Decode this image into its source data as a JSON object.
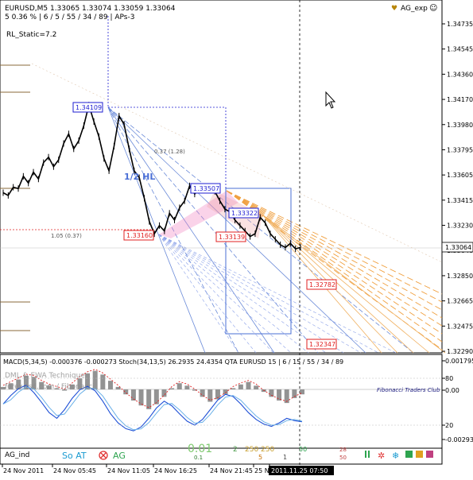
{
  "header": {
    "line1": "EURUSD,M5  1.33065 1.33074 1.33059 1.33064",
    "line2": "5  0.36 %  |  6 / 5 / 55 / 34 / 89  |  APs-3",
    "indicator_label": "RL_Static=7.2",
    "ea_label": "AG_exp",
    "ea_icon": "heart-icon",
    "smiley_icon": "smiley-icon"
  },
  "annotations": {
    "half_hl": "1/2 HL",
    "fib_a": "0.37 (1.28)",
    "fib_b": "1.05 (0.37)"
  },
  "price_boxes": [
    {
      "label": "1.34109",
      "color": "#1e1ed2"
    },
    {
      "label": "1.33507",
      "color": "#1e1ed2"
    },
    {
      "label": "1.33322",
      "color": "#1e1ed2"
    },
    {
      "label": "1.33160",
      "color": "#e02020"
    },
    {
      "label": "1.33139",
      "color": "#e02020"
    },
    {
      "label": "1.32782",
      "color": "#e02020"
    },
    {
      "label": "1.32347",
      "color": "#e02020"
    }
  ],
  "current_price": "1.33064",
  "price_axis": [
    "1.34735",
    "1.34545",
    "1.34360",
    "1.34170",
    "1.33980",
    "1.33795",
    "1.33605",
    "1.33415",
    "1.33230",
    "1.33040",
    "1.32850",
    "1.32665",
    "1.32475",
    "1.32290"
  ],
  "macd_panel": {
    "header": "MACD(5,34,5) -0.000376 -0.000273  Stoch(34,13,5) 26.2935 24.4354  QTA EURUSD 15  |  6 / 15 / 55 / 34 / 89",
    "watermark1": "DML & EWA Technique",
    "watermark2": "forex-tsd.com / Fibonacci",
    "club_label": "Fibonacci Traders Club",
    "axis": [
      "0.001795",
      "80",
      "0.00",
      "20",
      "-0.00293"
    ]
  },
  "bottom_bar": {
    "ag_label": "AG_ind",
    "so_at": "So AT",
    "ag": "AG",
    "value1": "0.01",
    "value1_sub": "0.1",
    "value2": "2",
    "value3": "250 250",
    "value3_sub": "5",
    "value4": "1",
    "value5": "50",
    "value6": "28",
    "value6_sub": "50"
  },
  "time_axis": [
    "24 Nov 2011",
    "24 Nov 05:45",
    "24 Nov 11:05",
    "24 Nov 16:25",
    "24 Nov 21:45",
    "25 N",
    "2011.11.25 07:50"
  ],
  "chart_data": {
    "type": "line",
    "title": "EURUSD,M5",
    "series": [
      {
        "name": "EURUSD",
        "values": [
          1.3346,
          1.3344,
          1.335,
          1.3349,
          1.3358,
          1.3353,
          1.3361,
          1.3356,
          1.3368,
          1.3372,
          1.3365,
          1.337,
          1.3382,
          1.3389,
          1.3378,
          1.3384,
          1.3395,
          1.341,
          1.3398,
          1.3387,
          1.3371,
          1.3362,
          1.338,
          1.3402,
          1.3396,
          1.3378,
          1.3362,
          1.3357,
          1.3342,
          1.3325,
          1.3316,
          1.3322,
          1.3318,
          1.3331,
          1.3326,
          1.3335,
          1.334,
          1.3351,
          1.3345,
          1.3349,
          1.3348,
          1.335,
          1.3347,
          1.334,
          1.3334,
          1.3332,
          1.3326,
          1.3322,
          1.3318,
          1.3314,
          1.3316,
          1.3328,
          1.3324,
          1.3316,
          1.3312,
          1.3308,
          1.3306,
          1.3309,
          1.3305,
          1.3306
        ]
      }
    ],
    "macd": [
      0.0002,
      0.0005,
      0.0008,
      0.0011,
      0.001,
      0.0006,
      0.0003,
      0.0001,
      -0.0001,
      0.0004,
      0.0009,
      0.0013,
      0.0015,
      0.0012,
      0.0007,
      0.0002,
      -0.0004,
      -0.0009,
      -0.0013,
      -0.0016,
      -0.0012,
      -0.0006,
      0.0001,
      0.0005,
      0.0003,
      -0.0001,
      -0.0006,
      -0.001,
      -0.0008,
      -0.0004,
      0.0001,
      0.0004,
      0.0006,
      0.0003,
      -0.0002,
      -0.0006,
      -0.0009,
      -0.0011,
      -0.0007,
      -0.0004
    ],
    "stoch_main": [
      55,
      70,
      82,
      88,
      75,
      58,
      40,
      30,
      45,
      65,
      80,
      86,
      78,
      60,
      38,
      22,
      12,
      8,
      15,
      30,
      48,
      60,
      52,
      38,
      25,
      18,
      28,
      45,
      62,
      72,
      68,
      55,
      40,
      28,
      20,
      16,
      22,
      30,
      26,
      24
    ],
    "ylim": [
      1.3229,
      1.3474
    ]
  }
}
